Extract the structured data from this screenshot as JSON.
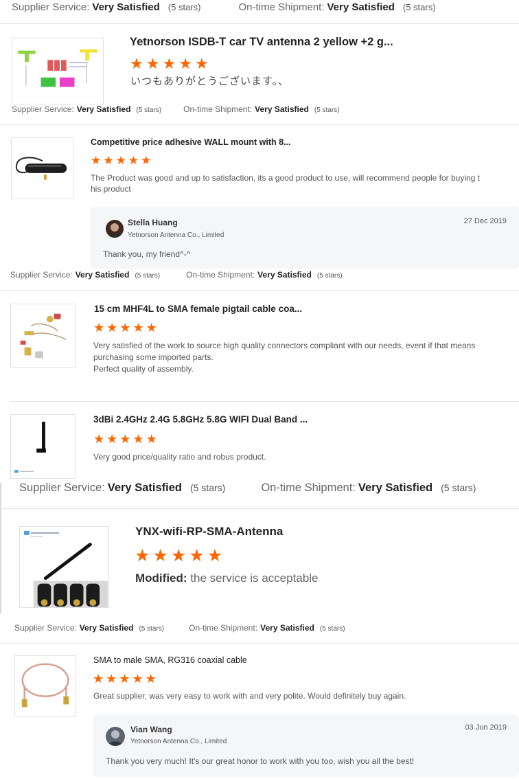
{
  "rating_labels": {
    "supplier": "Supplier Service:",
    "shipment": "On-time Shipment:",
    "value": "Very Satisfied",
    "stars": "(5 stars)"
  },
  "reviews": [
    {
      "title": "Yetnorson ISDB-T car TV antenna 2 yellow +2 g...",
      "stars": 5,
      "text": [
        "いつもありがとうございます。、"
      ]
    },
    {
      "title": "Competitive price adhesive WALL mount with 8...",
      "stars": 5,
      "text": [
        "The Product was good and up to satisfaction, its a good product to use, will recommend people for buying t",
        "his product"
      ],
      "reply": {
        "name": "Stella Huang",
        "company": "Yetnorson Antenna Co., Limited",
        "date": "27 Dec 2019",
        "text": "Thank you, my friend^-^"
      }
    },
    {
      "title": "15 cm MHF4L to SMA female pigtail cable coa...",
      "stars": 5,
      "text": [
        "Very satisfied of the work to source high quality connectors compliant with our needs, event if that means",
        "purchasing some imported parts.",
        "Perfect quality of assembly."
      ]
    },
    {
      "title": "3dBi 2.4GHz 2.4G 5.8GHz 5.8G WIFI Dual Band ...",
      "stars": 5,
      "text": [
        "Very good price/quality ratio and robus product."
      ]
    },
    {
      "title": "YNX-wifi-RP-SMA-Antenna",
      "stars": 5,
      "modified_label": "Modified:",
      "text": [
        "the service is acceptable"
      ]
    },
    {
      "title": "SMA to male SMA, RG316 coaxial cable",
      "stars": 5,
      "text": [
        "Great supplier, was very easy to work with and very polite. Would definitely buy again."
      ],
      "reply": {
        "name": "Vian Wang",
        "company": "Yetnorson Antenna Co., Limited",
        "date": "03 Jun 2019",
        "text": "Thank you very much! It's our great honor to work with you too, wish you all the best!"
      }
    }
  ],
  "colors": {
    "star": "#ff6600",
    "divider": "#e3e3e3",
    "reply_bg": "#f5f6f8",
    "text_dark": "#222222",
    "text_muted": "#555555"
  },
  "icons": [
    "star-icon",
    "avatar"
  ]
}
